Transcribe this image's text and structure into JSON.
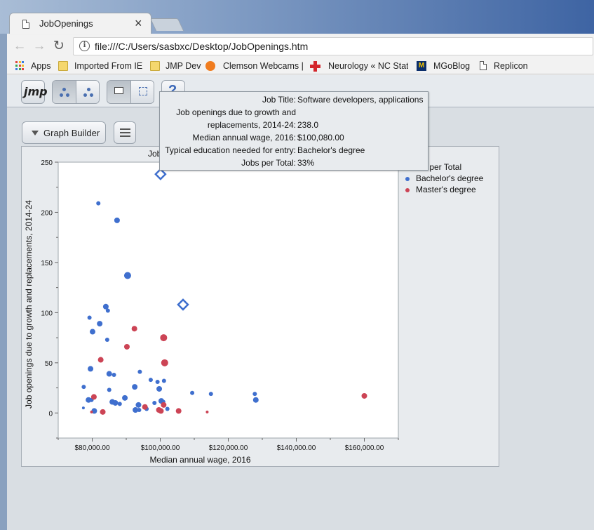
{
  "browser": {
    "tab_title": "JobOpenings",
    "tab_close": "×",
    "url": "file:///C:/Users/sasbxc/Desktop/JobOpenings.htm",
    "bookmarks": [
      {
        "label": "Apps",
        "icon": "apps-grid-icon"
      },
      {
        "label": "Imported From IE",
        "icon": "folder-icon"
      },
      {
        "label": "JMP Dev",
        "icon": "folder-icon"
      },
      {
        "label": "Clemson Webcams |",
        "icon": "paw-icon"
      },
      {
        "label": "Neurology « NC State",
        "icon": "red-cross-icon"
      },
      {
        "label": "MGoBlog",
        "icon": "block-m-icon"
      },
      {
        "label": "Replicon",
        "icon": "page-icon"
      }
    ],
    "mgoblog_icon_letter": "M"
  },
  "jmp": {
    "logo": "jmp",
    "help_label": "?",
    "graph_builder_label": "Graph Builder",
    "graph_title_partial": "Job"
  },
  "tooltip": {
    "rows": [
      {
        "k": "Job Title:",
        "v": "Software developers, applications"
      },
      {
        "k": "Job openings due to growth and",
        "v": ""
      },
      {
        "k": "replacements, 2014-24:",
        "v": "238.0"
      },
      {
        "k": "Median annual wage, 2016:",
        "v": "$100,080.00"
      },
      {
        "k": "Typical education needed for entry:",
        "v": "Bachelor's degree"
      },
      {
        "k": "Jobs per Total:",
        "v": "33%"
      }
    ]
  },
  "legend": {
    "title_partial": "s per Total",
    "items": [
      {
        "label": "Bachelor's degree",
        "color": "#3f6fce"
      },
      {
        "label": "Master's degree",
        "color": "#cc4455"
      }
    ]
  },
  "chart_data": {
    "type": "scatter",
    "title": "",
    "xlabel": "Median annual wage, 2016",
    "ylabel": "Job openings due to growth and replacements, 2014-24",
    "xlim": [
      70000,
      170000
    ],
    "ylim": [
      -25,
      250
    ],
    "xticks": [
      80000,
      100000,
      120000,
      140000,
      160000
    ],
    "xtick_labels": [
      "$80,000.00",
      "$100,000.00",
      "$120,000.00",
      "$140,000.00",
      "$160,000.00"
    ],
    "yticks": [
      0,
      50,
      100,
      150,
      200,
      250
    ],
    "ytick_labels": [
      "0",
      "50",
      "100",
      "150",
      "200",
      "250"
    ],
    "grid": false,
    "legend_position": "right",
    "series": [
      {
        "name": "Bachelor's degree",
        "color": "#3f6fce",
        "points": [
          {
            "x": 81800,
            "y": 209,
            "s": 3
          },
          {
            "x": 87300,
            "y": 192,
            "s": 4
          },
          {
            "x": 90400,
            "y": 137,
            "s": 5
          },
          {
            "x": 84000,
            "y": 106,
            "s": 4
          },
          {
            "x": 84600,
            "y": 102,
            "s": 3
          },
          {
            "x": 79200,
            "y": 95,
            "s": 3
          },
          {
            "x": 82200,
            "y": 89,
            "s": 4
          },
          {
            "x": 80100,
            "y": 81,
            "s": 4
          },
          {
            "x": 84400,
            "y": 73,
            "s": 3
          },
          {
            "x": 79500,
            "y": 44,
            "s": 4
          },
          {
            "x": 85000,
            "y": 39,
            "s": 4
          },
          {
            "x": 86400,
            "y": 38,
            "s": 3
          },
          {
            "x": 94000,
            "y": 41,
            "s": 3
          },
          {
            "x": 97200,
            "y": 33,
            "s": 3
          },
          {
            "x": 99200,
            "y": 31,
            "s": 3
          },
          {
            "x": 101100,
            "y": 32,
            "s": 3
          },
          {
            "x": 77500,
            "y": 26,
            "s": 3
          },
          {
            "x": 92500,
            "y": 26,
            "s": 4
          },
          {
            "x": 85000,
            "y": 23,
            "s": 3
          },
          {
            "x": 99700,
            "y": 24,
            "s": 4
          },
          {
            "x": 109400,
            "y": 20,
            "s": 3
          },
          {
            "x": 114900,
            "y": 19,
            "s": 3
          },
          {
            "x": 127800,
            "y": 19,
            "s": 3
          },
          {
            "x": 128100,
            "y": 13,
            "s": 4
          },
          {
            "x": 78900,
            "y": 13,
            "s": 4
          },
          {
            "x": 79800,
            "y": 13,
            "s": 3
          },
          {
            "x": 89600,
            "y": 15,
            "s": 4
          },
          {
            "x": 85900,
            "y": 11,
            "s": 4
          },
          {
            "x": 86800,
            "y": 10,
            "s": 4
          },
          {
            "x": 88100,
            "y": 9,
            "s": 3
          },
          {
            "x": 93600,
            "y": 8,
            "s": 4
          },
          {
            "x": 98300,
            "y": 10,
            "s": 3
          },
          {
            "x": 100300,
            "y": 12,
            "s": 4
          },
          {
            "x": 100900,
            "y": 11,
            "s": 3
          },
          {
            "x": 92700,
            "y": 3,
            "s": 4
          },
          {
            "x": 93800,
            "y": 3,
            "s": 3
          },
          {
            "x": 96000,
            "y": 4,
            "s": 3
          },
          {
            "x": 80600,
            "y": 2,
            "s": 4
          },
          {
            "x": 102100,
            "y": 4,
            "s": 3
          },
          {
            "x": 77400,
            "y": 5,
            "s": 2
          }
        ]
      },
      {
        "name": "Master's degree",
        "color": "#cc4455",
        "points": [
          {
            "x": 92400,
            "y": 84,
            "s": 4
          },
          {
            "x": 101000,
            "y": 75,
            "s": 5
          },
          {
            "x": 90200,
            "y": 66,
            "s": 4
          },
          {
            "x": 82500,
            "y": 53,
            "s": 4
          },
          {
            "x": 101300,
            "y": 50,
            "s": 5
          },
          {
            "x": 80500,
            "y": 16,
            "s": 4
          },
          {
            "x": 160000,
            "y": 17,
            "s": 4
          },
          {
            "x": 101000,
            "y": 8,
            "s": 4
          },
          {
            "x": 95500,
            "y": 6,
            "s": 4
          },
          {
            "x": 99600,
            "y": 3,
            "s": 4
          },
          {
            "x": 100200,
            "y": 2,
            "s": 4
          },
          {
            "x": 105400,
            "y": 2,
            "s": 4
          },
          {
            "x": 83100,
            "y": 1,
            "s": 4
          },
          {
            "x": 79800,
            "y": 1,
            "s": 2
          },
          {
            "x": 113800,
            "y": 1,
            "s": 2
          }
        ]
      }
    ],
    "highlighted": [
      {
        "x": 100080,
        "y": 238,
        "series": "Bachelor's degree"
      },
      {
        "x": 106700,
        "y": 108,
        "series": "Bachelor's degree"
      }
    ]
  }
}
